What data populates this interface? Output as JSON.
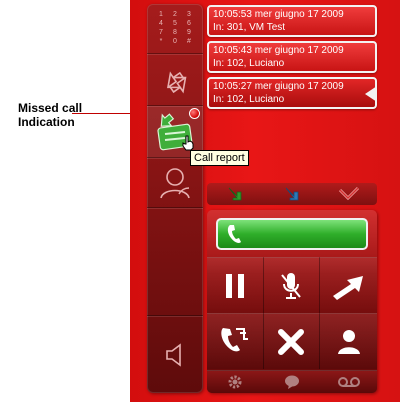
{
  "annotation": {
    "line1": "Missed call",
    "line2": "Indication"
  },
  "keypad": {
    "keys": [
      "1",
      "2",
      "3",
      "4",
      "5",
      "6",
      "7",
      "8",
      "9",
      "*",
      "0",
      "#"
    ]
  },
  "tooltip": {
    "text": "Call report"
  },
  "call_history": [
    {
      "time": "10:05:53 mer giugno 17 2009",
      "caller": "In: 301, VM Test"
    },
    {
      "time": "10:05:43 mer giugno 17 2009",
      "caller": "In: 102, Luciano"
    },
    {
      "time": "10:05:27 mer giugno 17 2009",
      "caller": "In: 102, Luciano"
    }
  ],
  "colors": {
    "body_red": "#e81616",
    "call_green": "#2fae2a",
    "missed_dot": "#d00000",
    "toolbar_green": "#2f9b2b",
    "toolbar_blue": "#2c79b8",
    "toolbar_red": "#d23030"
  },
  "icons": {
    "sidebar": [
      "keypad-icon",
      "transfer-icon",
      "call-history-icon",
      "contacts-icon",
      "speaker-icon"
    ],
    "history_toolbar": [
      "green-arrow-icon",
      "blue-arrow-icon",
      "red-arrow-icon"
    ],
    "call_panel": [
      "handset-icon",
      "pause-icon",
      "mute-mic-icon",
      "forward-arrow-icon",
      "conference-icon",
      "hangup-x-icon",
      "person-icon",
      "gear-icon",
      "chat-bubble-icon",
      "voicemail-icon"
    ]
  }
}
